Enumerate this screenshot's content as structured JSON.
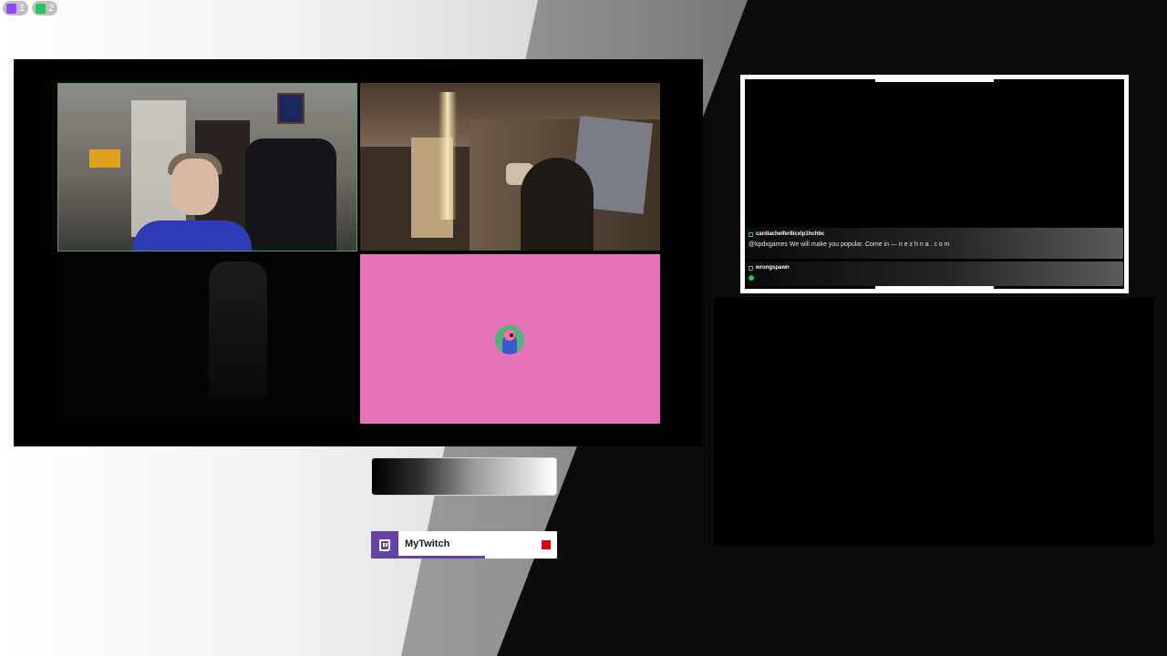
{
  "badges": [
    {
      "icon": "twitch-icon",
      "count": "1",
      "color": "#9146ff"
    },
    {
      "icon": "kick-icon",
      "count": "2",
      "color": "#22c55e"
    }
  ],
  "video_grid": {
    "tiles": [
      {
        "name": "webcam-player-1"
      },
      {
        "name": "webcam-player-2"
      },
      {
        "name": "webcam-player-3"
      },
      {
        "name": "avatar-player-4",
        "background": "#e772b7"
      }
    ]
  },
  "chat": {
    "messages": [
      {
        "user": "cardiacheifer8icxlp1hchbc",
        "text": "@kpdxgames We will make you popular. Come in — n e z h n a . c o m"
      },
      {
        "user": "wrongspawn",
        "text": ""
      }
    ]
  },
  "channel_card": {
    "name": "MyTwitch",
    "platform_color": "#6441a5",
    "live_color": "#e00000"
  }
}
